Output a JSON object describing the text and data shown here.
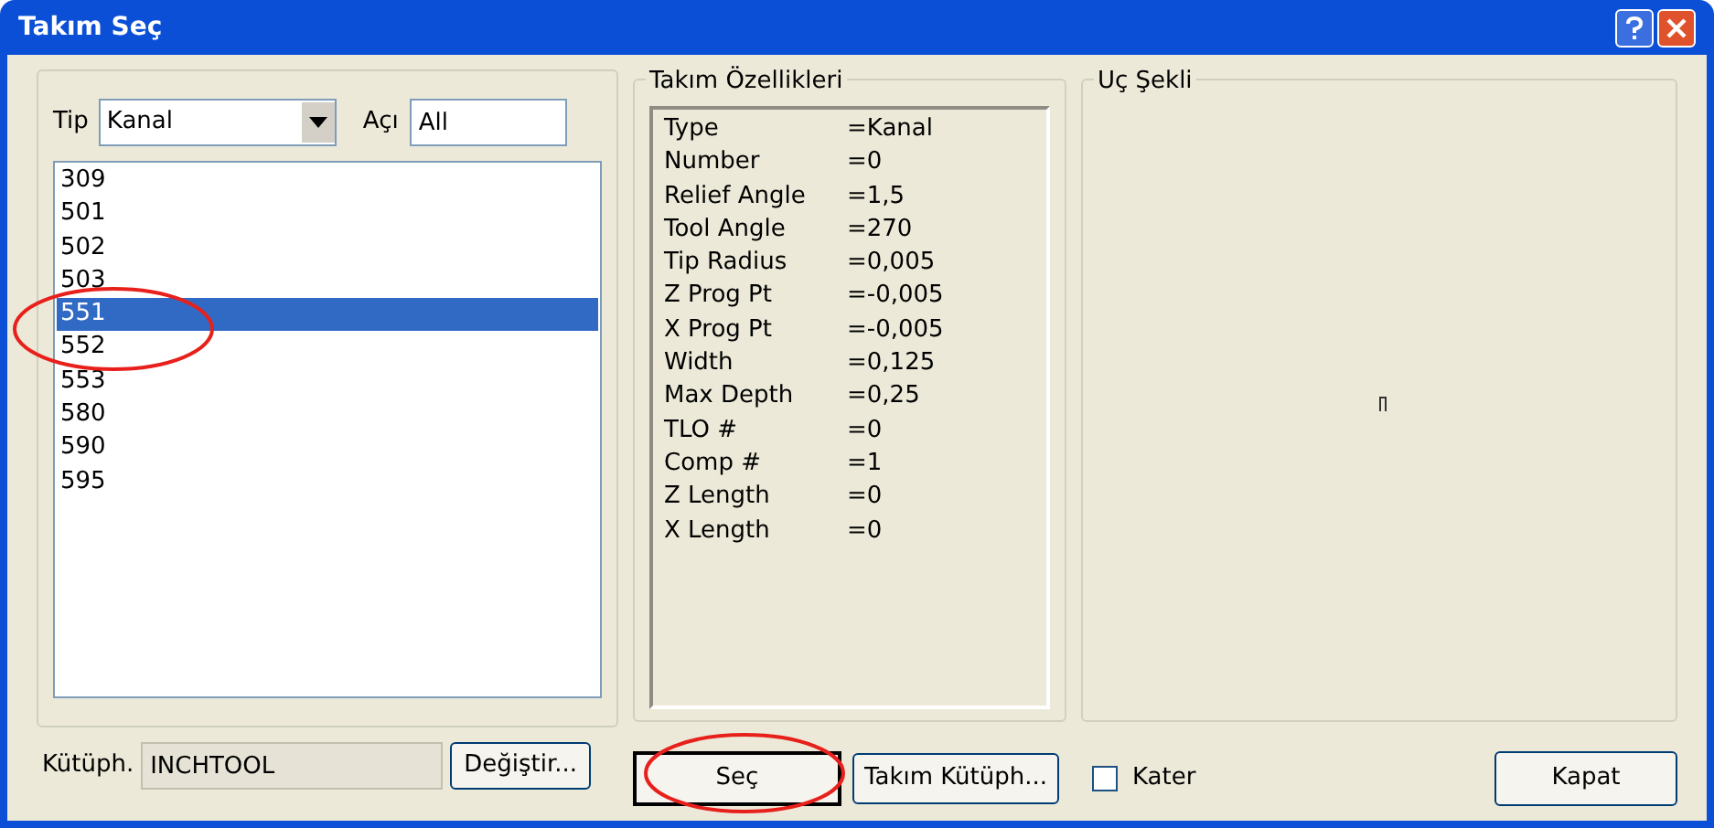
{
  "window": {
    "title": "Takım Seç"
  },
  "filter": {
    "type_label": "Tip",
    "type_value": "Kanal",
    "angle_label": "Açı",
    "angle_value": "All"
  },
  "tools": [
    {
      "label": "309",
      "selected": false
    },
    {
      "label": "501",
      "selected": false
    },
    {
      "label": "502",
      "selected": false
    },
    {
      "label": "503",
      "selected": false
    },
    {
      "label": "551",
      "selected": true
    },
    {
      "label": "552",
      "selected": false
    },
    {
      "label": "553",
      "selected": false
    },
    {
      "label": "580",
      "selected": false
    },
    {
      "label": "590",
      "selected": false
    },
    {
      "label": "595",
      "selected": false
    }
  ],
  "library": {
    "label": "Kütüph.",
    "value": "INCHTOOL",
    "button": "Değiştir..."
  },
  "properties": {
    "title": "Takım Özellikleri",
    "rows": [
      {
        "name": "Type",
        "value": "=Kanal"
      },
      {
        "name": "Number",
        "value": "=0"
      },
      {
        "name": "Relief Angle",
        "value": "=1,5"
      },
      {
        "name": "Tool Angle",
        "value": "=270"
      },
      {
        "name": "Tip Radius",
        "value": "=0,005"
      },
      {
        "name": "Z Prog Pt",
        "value": "=-0,005"
      },
      {
        "name": "X Prog Pt",
        "value": "=-0,005"
      },
      {
        "name": "Width",
        "value": "=0,125"
      },
      {
        "name": "Max Depth",
        "value": "=0,25"
      },
      {
        "name": "TLO #",
        "value": "=0"
      },
      {
        "name": "Comp #",
        "value": "=1"
      },
      {
        "name": "Z Length",
        "value": "=0"
      },
      {
        "name": "X Length",
        "value": "=0"
      }
    ]
  },
  "shape": {
    "title": "Uç Şekli"
  },
  "buttons": {
    "select": "Seç",
    "library": "Takım Kütüph...",
    "close": "Kapat"
  },
  "cutter": {
    "label": "Kater",
    "checked": false
  }
}
